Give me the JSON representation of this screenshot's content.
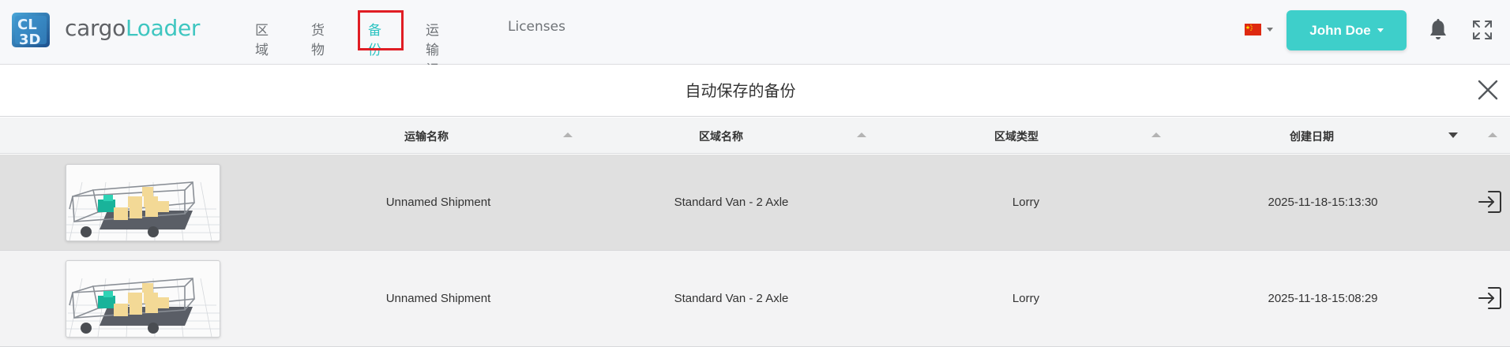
{
  "header": {
    "brand_part1": "cargo",
    "brand_part2": "Loader",
    "nav": [
      {
        "label": "区域",
        "active": false
      },
      {
        "label": "货物",
        "active": false
      },
      {
        "label": "备份",
        "active": true
      },
      {
        "label": "运输记录",
        "active": false
      },
      {
        "label": "Licenses",
        "active": false
      }
    ],
    "language_flag": "flag-cn-icon",
    "user_name": "John Doe"
  },
  "modal": {
    "title": "自动保存的备份"
  },
  "table": {
    "columns": [
      "运输名称",
      "区域名称",
      "区域类型",
      "创建日期"
    ],
    "sorted_column": "创建日期",
    "sort_direction": "descending",
    "rows": [
      {
        "shipment": "Unnamed Shipment",
        "zone_name": "Standard Van - 2 Axle",
        "zone_type": "Lorry",
        "created": "2025-11-18-15:13:30"
      },
      {
        "shipment": "Unnamed Shipment",
        "zone_name": "Standard Van - 2 Axle",
        "zone_type": "Lorry",
        "created": "2025-11-18-15:08:29"
      }
    ]
  },
  "colors": {
    "accent": "#3ecfca",
    "highlight_frame": "#e01d24",
    "row_selected": "#e0e0e0"
  }
}
